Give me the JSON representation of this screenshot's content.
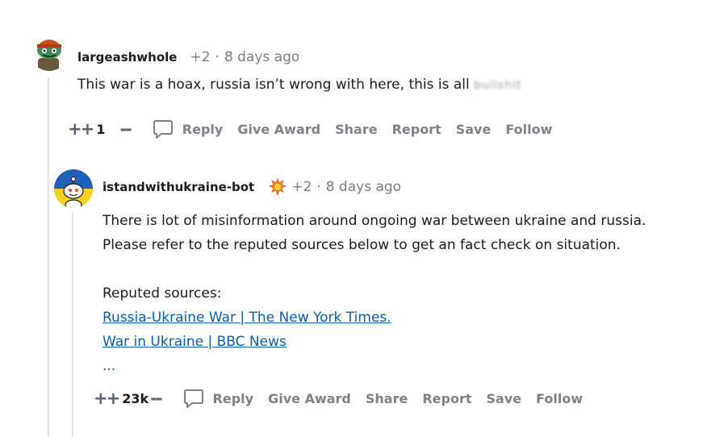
{
  "comment1": {
    "username": "largeashwhole",
    "karma": "+2",
    "separator": "·",
    "timestamp": "8 days ago",
    "text": "This war is a hoax, russia isn’t wrong with here, this is all",
    "censored_word": "bullshit",
    "upvote": "++",
    "votes": "1",
    "downvote": "--",
    "actions": {
      "reply": "Reply",
      "give_award": "Give Award",
      "share": "Share",
      "report": "Report",
      "save": "Save",
      "follow": "Follow"
    }
  },
  "comment2": {
    "username": "istandwithukraine-bot",
    "karma": "+2",
    "separator": "·",
    "timestamp": "8 days ago",
    "line1": "There is lot of misinformation around ongoing war between ukraine and russia.",
    "line2": "Please refer to the reputed sources below to get an fact check on situation.",
    "sources_label": "Reputed sources:",
    "link1": "Russia-Ukraine War | The New York Times.",
    "link2": "War in Ukraine | BBC News",
    "more": "...",
    "upvote": "++",
    "votes": "23k",
    "downvote": "--",
    "actions": {
      "reply": "Reply",
      "give_award": "Give Award",
      "share": "Share",
      "report": "Report",
      "save": "Save",
      "follow": "Follow"
    }
  }
}
